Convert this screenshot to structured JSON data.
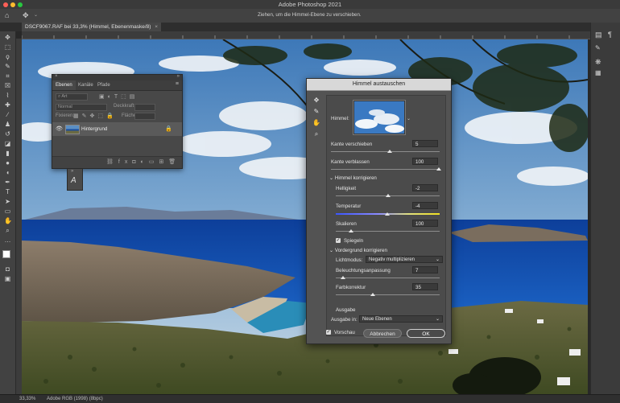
{
  "app": {
    "title": "Adobe Photoshop 2021"
  },
  "options_bar": {
    "hint": "Ziehen, um die Himmel-Ebene zu verschieben."
  },
  "document": {
    "tab_label": "DSCF9067.RAF bei 33,3% (Himmel, Ebenenmaske/8)"
  },
  "status": {
    "zoom": "33,33%",
    "profile": "Adobe RGB (1998) (8bpc)"
  },
  "layers_panel": {
    "tabs": [
      "Ebenen",
      "Kanäle",
      "Pfade"
    ],
    "search_placeholder": "Art",
    "blend_mode": "Normal",
    "opacity_label": "Deckkraft:",
    "lock_label": "Fixieren:",
    "fill_label": "Fläche:",
    "layer_name": "Hintergrund"
  },
  "sky_dialog": {
    "title": "Himmel austauschen",
    "sky_label": "Himmel:",
    "shift_edge": {
      "label": "Kante verschieben",
      "value": "5"
    },
    "fade_edge": {
      "label": "Kante verblassen",
      "value": "100"
    },
    "sky_adjust_header": "Himmel korrigieren",
    "brightness": {
      "label": "Helligkeit",
      "value": "-2"
    },
    "temperature": {
      "label": "Temperatur",
      "value": "-4"
    },
    "scale": {
      "label": "Skalieren",
      "value": "100"
    },
    "flip_label": "Spiegeln",
    "fg_adjust_header": "Vordergrund korrigieren",
    "light_mode_label": "Lichtmodus:",
    "light_mode_value": "Negativ multiplizieren",
    "lighting_adjust": {
      "label": "Beleuchtungsanpassung",
      "value": "7"
    },
    "color_adjust": {
      "label": "Farbkorrektur",
      "value": "35"
    },
    "output_header": "Ausgabe",
    "output_to_label": "Ausgabe in:",
    "output_to_value": "Neue Ebenen",
    "preview_label": "Vorschau",
    "cancel_label": "Abbrechen",
    "ok_label": "OK"
  }
}
